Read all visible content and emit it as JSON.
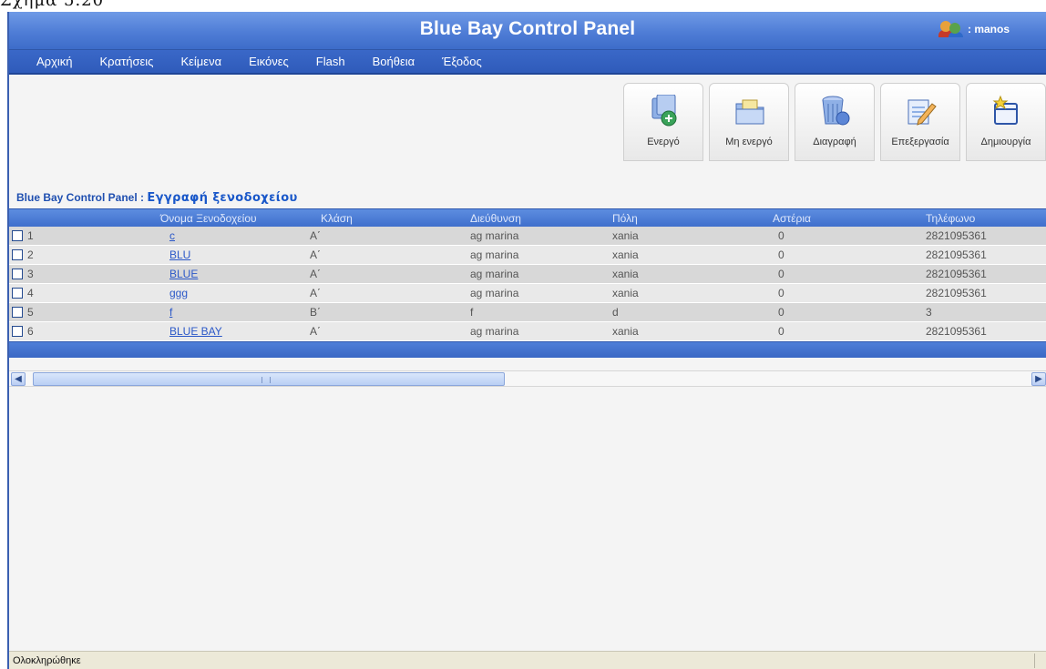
{
  "figure_caption": "Σχήμα 5.20",
  "app": {
    "title": "Blue Bay Control Panel",
    "user": ": manos"
  },
  "menu": [
    "Αρχική",
    "Κρατήσεις",
    "Κείμενα",
    "Εικόνες",
    "Flash",
    "Βοήθεια",
    "Έξοδος"
  ],
  "toolbar": [
    {
      "label": "Ενεργό",
      "icon": "active-icon"
    },
    {
      "label": "Μη ενεργό",
      "icon": "inactive-folder-icon"
    },
    {
      "label": "Διαγραφή",
      "icon": "trash-icon"
    },
    {
      "label": "Επεξεργασία",
      "icon": "edit-icon"
    },
    {
      "label": "Δημιουργία",
      "icon": "create-icon"
    }
  ],
  "page": {
    "heading_prefix": "Blue Bay Control Panel : ",
    "heading": "Εγγραφή ξενοδοχείου"
  },
  "table": {
    "columns": [
      "Όνομα Ξενοδοχείου",
      "Κλάση",
      "Διεύθυνση",
      "Πόλη",
      "Αστέρια",
      "Τηλέφωνο"
    ],
    "rows": [
      {
        "id": "1",
        "name": "c",
        "class": "A΄",
        "address": "ag marina",
        "city": "xania",
        "stars": "0",
        "phone": "2821095361"
      },
      {
        "id": "2",
        "name": "BLU",
        "class": "A΄",
        "address": "ag marina",
        "city": "xania",
        "stars": "0",
        "phone": "2821095361"
      },
      {
        "id": "3",
        "name": "BLUE",
        "class": "A΄",
        "address": "ag marina",
        "city": "xania",
        "stars": "0",
        "phone": "2821095361"
      },
      {
        "id": "4",
        "name": "ggg",
        "class": "A΄",
        "address": "ag marina",
        "city": "xania",
        "stars": "0",
        "phone": "2821095361"
      },
      {
        "id": "5",
        "name": "f",
        "class": "B΄",
        "address": "f",
        "city": "d",
        "stars": "0",
        "phone": "3"
      },
      {
        "id": "6",
        "name": "BLUE BAY",
        "class": "A΄",
        "address": "ag marina",
        "city": "xania",
        "stars": "0",
        "phone": "2821095361"
      }
    ]
  },
  "scrollbar": {
    "grip": "III"
  },
  "status": {
    "text": "Ολοκληρώθηκε"
  },
  "colors": {
    "title_bar": "#4f7dd6",
    "menu_bar": "#2f5bba",
    "link": "#2b58c8",
    "row_odd": "#d8d8d8",
    "row_even": "#e9e9e9"
  }
}
